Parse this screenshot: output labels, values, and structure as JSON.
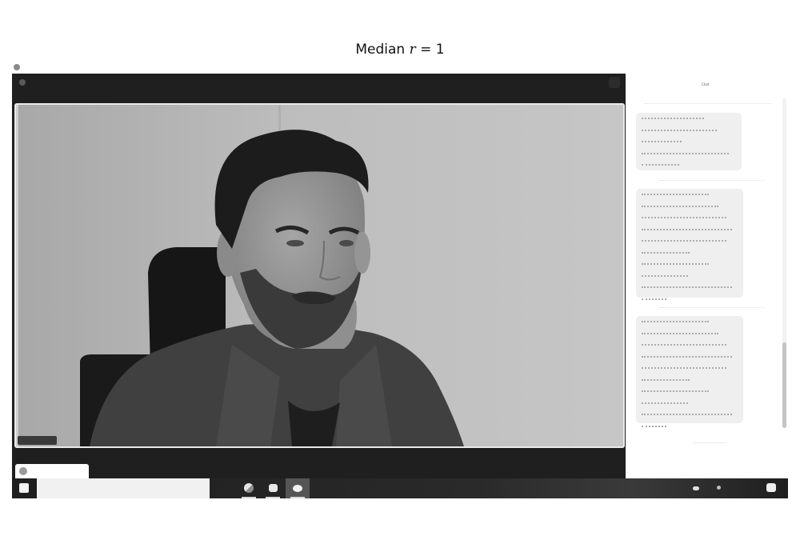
{
  "figure": {
    "title_prefix": "Median ",
    "title_var": "r",
    "title_suffix": " = 1"
  },
  "window": {
    "title": "",
    "close_glyph": "·"
  },
  "stage": {
    "meeting_title": "",
    "view_button_icon": "layout-icon"
  },
  "video": {
    "participant_name_tag": ""
  },
  "self_view": {
    "label": ""
  },
  "chat": {
    "title": "Chat",
    "messages": [
      {
        "meta": "",
        "lines": 5
      },
      {
        "meta": "",
        "lines": 10
      },
      {
        "meta": "",
        "lines": 10
      }
    ],
    "footer": ""
  },
  "taskbar": {
    "search_placeholder": "",
    "apps": [
      {
        "name": "browser-icon",
        "active": false
      },
      {
        "name": "chat-app-icon",
        "active": false
      },
      {
        "name": "meeting-app-icon",
        "active": true
      }
    ],
    "clock_time": "",
    "clock_date": ""
  }
}
